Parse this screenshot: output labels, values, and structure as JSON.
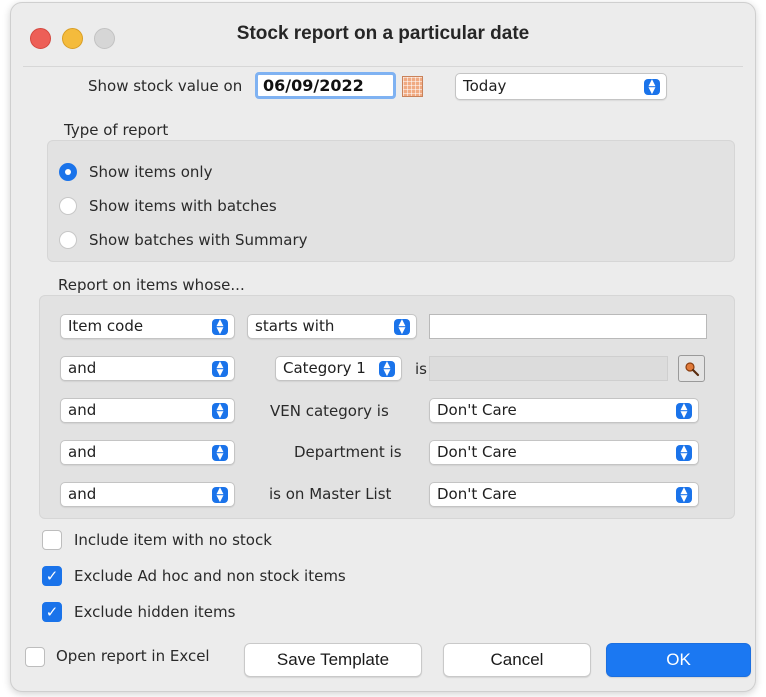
{
  "window": {
    "title": "Stock report on a particular date"
  },
  "date_row": {
    "label": "Show stock value on",
    "date_value": "06/09/2022",
    "preset_selected": "Today"
  },
  "report_type": {
    "heading": "Type of report",
    "options": [
      {
        "label": "Show items only",
        "selected": true
      },
      {
        "label": "Show items with batches",
        "selected": false
      },
      {
        "label": "Show batches with Summary",
        "selected": false
      }
    ]
  },
  "filters": {
    "heading": "Report on items whose...",
    "row1": {
      "field": "Item code",
      "operator": "starts with",
      "value": ""
    },
    "row2": {
      "conjunction": "and",
      "field": "Category 1",
      "operator_label": "is",
      "value": ""
    },
    "row3": {
      "conjunction": "and",
      "label": "VEN category is",
      "value": "Don't Care"
    },
    "row4": {
      "conjunction": "and",
      "label": "Department is",
      "value": "Don't Care"
    },
    "row5": {
      "conjunction": "and",
      "label": "is on Master List",
      "value": "Don't Care"
    }
  },
  "options": {
    "include_no_stock": {
      "label": "Include item with no stock",
      "checked": false
    },
    "exclude_adhoc": {
      "label": "Exclude Ad hoc and non stock items",
      "checked": true
    },
    "exclude_hidden": {
      "label": "Exclude hidden items",
      "checked": true
    },
    "open_excel": {
      "label": "Open report in Excel",
      "checked": false
    },
    "check_mark": "✓"
  },
  "buttons": {
    "save_template": "Save Template",
    "cancel": "Cancel",
    "ok": "OK"
  },
  "colors": {
    "accent": "#1a73ea",
    "close": "#ed5f57",
    "minimize": "#f4bb3c",
    "maximize": "#d6d6d6"
  }
}
